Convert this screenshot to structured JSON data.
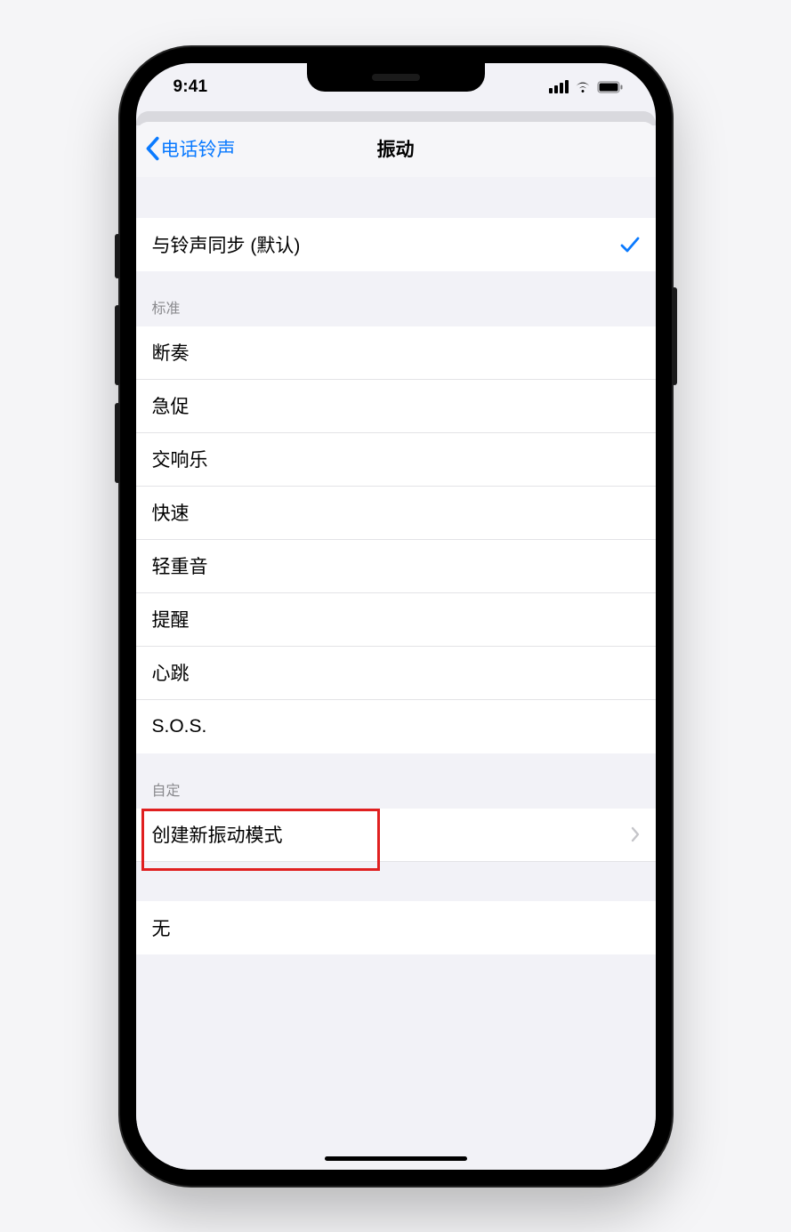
{
  "status": {
    "time": "9:41"
  },
  "nav": {
    "back_label": "电话铃声",
    "title": "振动"
  },
  "selected": {
    "label": "与铃声同步 (默认)"
  },
  "sections": {
    "standard": {
      "header": "标准",
      "items": [
        "断奏",
        "急促",
        "交响乐",
        "快速",
        "轻重音",
        "提醒",
        "心跳",
        "S.O.S."
      ]
    },
    "custom": {
      "header": "自定",
      "create_label": "创建新振动模式"
    },
    "none": {
      "label": "无"
    }
  },
  "colors": {
    "accent": "#0a7aff",
    "highlight": "#e02020"
  }
}
